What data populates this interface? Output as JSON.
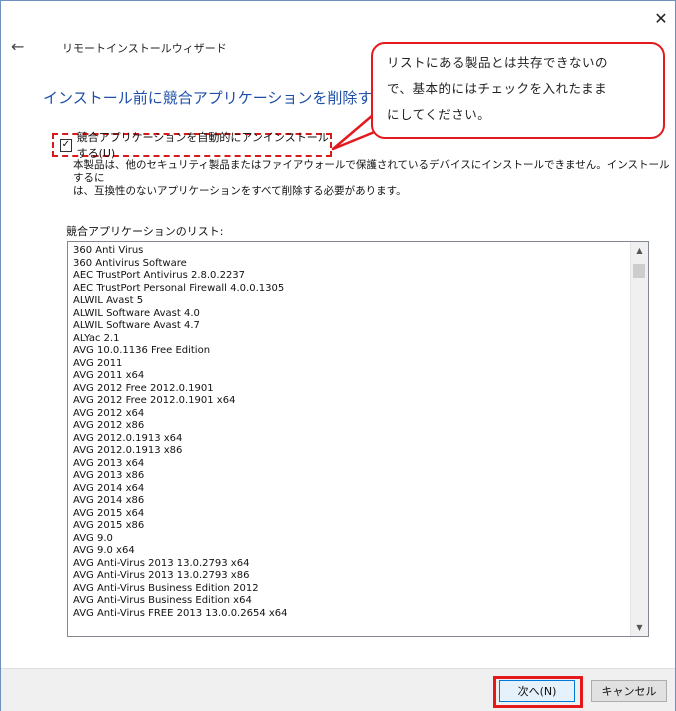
{
  "window": {
    "wizard_title": "リモートインストールウィザード",
    "close_icon": "close-icon",
    "back_icon": "back-arrow-icon"
  },
  "heading": "インストール前に競合アプリケーションを削除する",
  "callout": {
    "line1": "リストにある製品とは共存できないの",
    "line2": "で、基本的にはチェックを入れたまま",
    "line3": "にしてください。"
  },
  "checkbox": {
    "label": "競合アプリケーションを自動的にアンインストールする(U)",
    "checked": true
  },
  "description": {
    "line1": "本製品は、他のセキュリティ製品またはファイアウォールで保護されているデバイスにインストールできません。インストールするに",
    "line2": "は、互換性のないアプリケーションをすべて削除する必要があります。"
  },
  "list_label": "競合アプリケーションのリスト:",
  "applications": [
    "360 Anti Virus",
    "360 Antivirus Software",
    "AEC TrustPort Antivirus 2.8.0.2237",
    "AEC TrustPort Personal Firewall 4.0.0.1305",
    "ALWIL Avast 5",
    "ALWIL Software Avast 4.0",
    "ALWIL Software Avast 4.7",
    "ALYac 2.1",
    "AVG 10.0.1136 Free Edition",
    "AVG 2011",
    "AVG 2011 x64",
    "AVG 2012 Free 2012.0.1901",
    "AVG 2012 Free 2012.0.1901 x64",
    "AVG 2012 x64",
    "AVG 2012 x86",
    "AVG 2012.0.1913 x64",
    "AVG 2012.0.1913 x86",
    "AVG 2013 x64",
    "AVG 2013 x86",
    "AVG 2014 x64",
    "AVG 2014 x86",
    "AVG 2015 x64",
    "AVG 2015 x86",
    "AVG 9.0",
    "AVG 9.0 x64",
    "AVG Anti-Virus 2013 13.0.2793 x64",
    "AVG Anti-Virus 2013 13.0.2793 x86",
    "AVG Anti-Virus Business Edition 2012",
    "AVG Anti-Virus Business Edition x64",
    "AVG Anti-Virus FREE 2013 13.0.0.2654 x64"
  ],
  "buttons": {
    "next": "次へ(N)",
    "cancel": "キャンセル"
  },
  "colors": {
    "heading": "#1e4fa8",
    "highlight": "#e4191c"
  }
}
